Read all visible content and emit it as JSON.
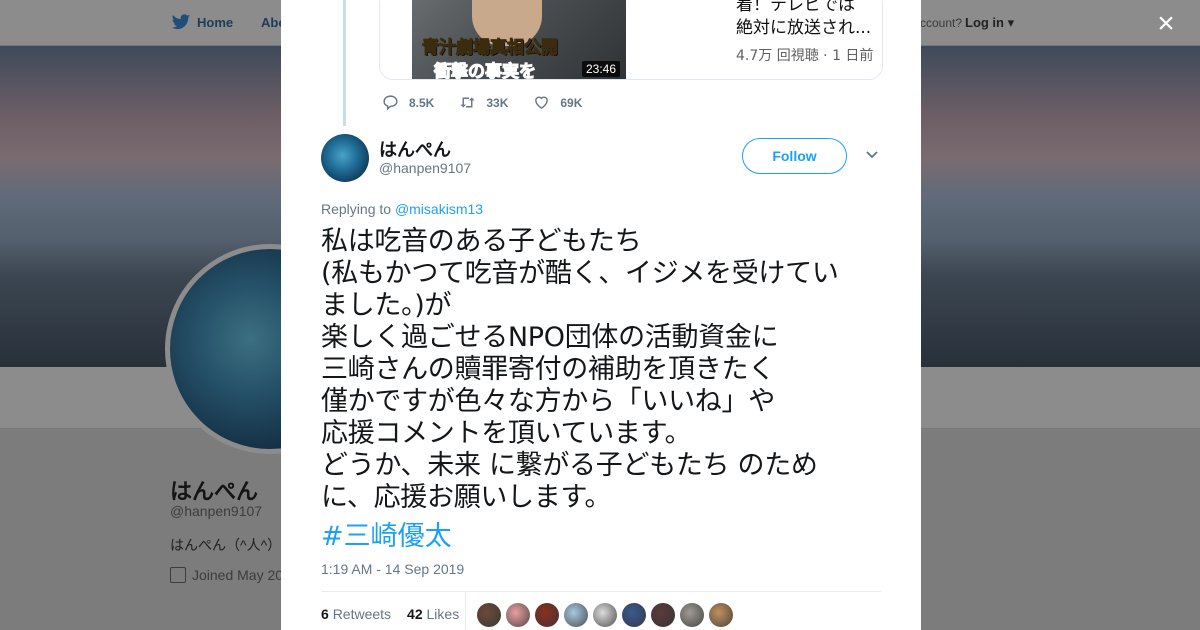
{
  "background": {
    "nav": {
      "home": "Home",
      "about": "Abo",
      "have_account": "ccount?",
      "login": "Log in"
    },
    "profile": {
      "name": "はんぺん",
      "handle": "@hanpen9107",
      "bio": "はんぺん（^人^）",
      "joined": "Joined May 20"
    }
  },
  "close_icon": "×",
  "quote_card": {
    "thumb_caption_top": "青汁劇場真相公開",
    "thumb_caption_bottom": "衝撃の事実を",
    "duration": "23:46",
    "title": "着！テレビでは\n絶対に放送され...",
    "meta": "4.7万 回視聴 · 1 日前"
  },
  "parent_actions": {
    "replies": "8.5K",
    "retweets": "33K",
    "likes": "69K"
  },
  "tweet": {
    "name": "はんぺん",
    "handle": "@hanpen9107",
    "follow_label": "Follow",
    "replying_prefix": "Replying to ",
    "replying_to": "@misakism13",
    "text": "私は吃音のある子どもたち\n(私もかつて吃音が酷く、イジメを受けてい\nました。)が\n楽しく過ごせるNPO団体の活動資金に\n三崎さんの贖罪寄付の補助を頂きたく\n僅かですが色々な方から「いいね」や\n応援コメントを頂いています。\nどうか、未来 に繋がる子どもたち のため\nに、応援お願いします。",
    "hashtag": "#三崎優太",
    "timestamp": "1:19 AM - 14 Sep 2019",
    "retweets_count": "6",
    "retweets_label": "Retweets",
    "likes_count": "42",
    "likes_label": "Likes"
  },
  "likers": [
    "#6b4a3a",
    "#e8a0a0",
    "#8a3020",
    "#a8c8e0",
    "#dcdcdc",
    "#3a5a90",
    "#5a3a3a",
    "#a09a94",
    "#c09060"
  ],
  "colors": {
    "accent": "#1da1f2",
    "text": "#14171a",
    "muted": "#657786"
  }
}
